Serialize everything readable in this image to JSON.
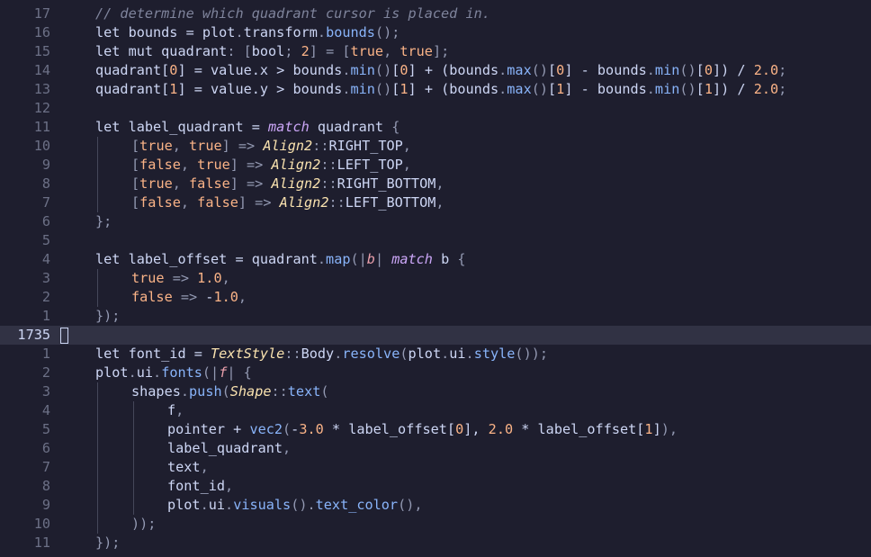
{
  "editor": {
    "current_line_number": "1735",
    "colors": {
      "background": "#1e1e2e",
      "current_line": "#313244",
      "gutter": "#6c7086",
      "text": "#cdd6f4",
      "comment": "#7f849c",
      "number": "#fab387",
      "function": "#89b4fa",
      "type": "#f9e2af",
      "keyword_italic": "#cba6f7"
    },
    "lines": [
      {
        "num": "17",
        "indent": 1,
        "tokens": [
          [
            "c",
            "// determine which quadrant cursor is placed in."
          ]
        ]
      },
      {
        "num": "16",
        "indent": 1,
        "tokens": [
          [
            "k",
            "let "
          ],
          [
            "p",
            "bounds = plot"
          ],
          [
            "u",
            "."
          ],
          [
            "p",
            "transform"
          ],
          [
            "u",
            "."
          ],
          [
            "f",
            "bounds"
          ],
          [
            "u",
            "();"
          ]
        ]
      },
      {
        "num": "15",
        "indent": 1,
        "tokens": [
          [
            "k",
            "let mut "
          ],
          [
            "p",
            "quadrant"
          ],
          [
            "u",
            ": ["
          ],
          [
            "p",
            "bool"
          ],
          [
            "u",
            "; "
          ],
          [
            "n",
            "2"
          ],
          [
            "u",
            "] = ["
          ],
          [
            "n",
            "true"
          ],
          [
            "u",
            ", "
          ],
          [
            "n",
            "true"
          ],
          [
            "u",
            "];"
          ]
        ]
      },
      {
        "num": "14",
        "indent": 1,
        "tokens": [
          [
            "p",
            "quadrant["
          ],
          [
            "n",
            "0"
          ],
          [
            "p",
            "] = value.x > bounds"
          ],
          [
            "u",
            "."
          ],
          [
            "f",
            "min"
          ],
          [
            "u",
            "()"
          ],
          [
            "p",
            "["
          ],
          [
            "n",
            "0"
          ],
          [
            "p",
            "] + (bounds"
          ],
          [
            "u",
            "."
          ],
          [
            "f",
            "max"
          ],
          [
            "u",
            "()"
          ],
          [
            "p",
            "["
          ],
          [
            "n",
            "0"
          ],
          [
            "p",
            "] - bounds"
          ],
          [
            "u",
            "."
          ],
          [
            "f",
            "min"
          ],
          [
            "u",
            "()"
          ],
          [
            "p",
            "["
          ],
          [
            "n",
            "0"
          ],
          [
            "p",
            "]) / "
          ],
          [
            "n",
            "2.0"
          ],
          [
            "u",
            ";"
          ]
        ]
      },
      {
        "num": "13",
        "indent": 1,
        "tokens": [
          [
            "p",
            "quadrant["
          ],
          [
            "n",
            "1"
          ],
          [
            "p",
            "] = value.y > bounds"
          ],
          [
            "u",
            "."
          ],
          [
            "f",
            "min"
          ],
          [
            "u",
            "()"
          ],
          [
            "p",
            "["
          ],
          [
            "n",
            "1"
          ],
          [
            "p",
            "] + (bounds"
          ],
          [
            "u",
            "."
          ],
          [
            "f",
            "max"
          ],
          [
            "u",
            "()"
          ],
          [
            "p",
            "["
          ],
          [
            "n",
            "1"
          ],
          [
            "p",
            "] - bounds"
          ],
          [
            "u",
            "."
          ],
          [
            "f",
            "min"
          ],
          [
            "u",
            "()"
          ],
          [
            "p",
            "["
          ],
          [
            "n",
            "1"
          ],
          [
            "p",
            "]) / "
          ],
          [
            "n",
            "2.0"
          ],
          [
            "u",
            ";"
          ]
        ]
      },
      {
        "num": "12",
        "indent": 0,
        "tokens": []
      },
      {
        "num": "11",
        "indent": 1,
        "tokens": [
          [
            "k",
            "let "
          ],
          [
            "p",
            "label_quadrant = "
          ],
          [
            "i",
            "match"
          ],
          [
            "p",
            " quadrant "
          ],
          [
            "u",
            "{"
          ]
        ]
      },
      {
        "num": "10",
        "indent": 2,
        "tokens": [
          [
            "u",
            "["
          ],
          [
            "n",
            "true"
          ],
          [
            "u",
            ", "
          ],
          [
            "n",
            "true"
          ],
          [
            "u",
            "] => "
          ],
          [
            "t",
            "Align2"
          ],
          [
            "u",
            "::"
          ],
          [
            "p",
            "RIGHT_TOP"
          ],
          [
            "u",
            ","
          ]
        ]
      },
      {
        "num": "9",
        "indent": 2,
        "tokens": [
          [
            "u",
            "["
          ],
          [
            "n",
            "false"
          ],
          [
            "u",
            ", "
          ],
          [
            "n",
            "true"
          ],
          [
            "u",
            "] => "
          ],
          [
            "t",
            "Align2"
          ],
          [
            "u",
            "::"
          ],
          [
            "p",
            "LEFT_TOP"
          ],
          [
            "u",
            ","
          ]
        ]
      },
      {
        "num": "8",
        "indent": 2,
        "tokens": [
          [
            "u",
            "["
          ],
          [
            "n",
            "true"
          ],
          [
            "u",
            ", "
          ],
          [
            "n",
            "false"
          ],
          [
            "u",
            "] => "
          ],
          [
            "t",
            "Align2"
          ],
          [
            "u",
            "::"
          ],
          [
            "p",
            "RIGHT_BOTTOM"
          ],
          [
            "u",
            ","
          ]
        ]
      },
      {
        "num": "7",
        "indent": 2,
        "tokens": [
          [
            "u",
            "["
          ],
          [
            "n",
            "false"
          ],
          [
            "u",
            ", "
          ],
          [
            "n",
            "false"
          ],
          [
            "u",
            "] => "
          ],
          [
            "t",
            "Align2"
          ],
          [
            "u",
            "::"
          ],
          [
            "p",
            "LEFT_BOTTOM"
          ],
          [
            "u",
            ","
          ]
        ]
      },
      {
        "num": "6",
        "indent": 1,
        "tokens": [
          [
            "u",
            "};"
          ]
        ]
      },
      {
        "num": "5",
        "indent": 0,
        "tokens": []
      },
      {
        "num": "4",
        "indent": 1,
        "tokens": [
          [
            "k",
            "let "
          ],
          [
            "p",
            "label_offset = quadrant"
          ],
          [
            "u",
            "."
          ],
          [
            "f",
            "map"
          ],
          [
            "u",
            "(|"
          ],
          [
            "a",
            "b"
          ],
          [
            "u",
            "| "
          ],
          [
            "i",
            "match"
          ],
          [
            "p",
            " b "
          ],
          [
            "u",
            "{"
          ]
        ]
      },
      {
        "num": "3",
        "indent": 2,
        "tokens": [
          [
            "n",
            "true"
          ],
          [
            "u",
            " => "
          ],
          [
            "n",
            "1.0"
          ],
          [
            "u",
            ","
          ]
        ]
      },
      {
        "num": "2",
        "indent": 2,
        "tokens": [
          [
            "n",
            "false"
          ],
          [
            "u",
            " => "
          ],
          [
            "p",
            "-"
          ],
          [
            "n",
            "1.0"
          ],
          [
            "u",
            ","
          ]
        ]
      },
      {
        "num": "1",
        "indent": 1,
        "tokens": [
          [
            "u",
            "});"
          ]
        ]
      },
      {
        "num": "1735",
        "indent": 0,
        "current": true,
        "tokens": []
      },
      {
        "num": "1",
        "indent": 1,
        "tokens": [
          [
            "k",
            "let "
          ],
          [
            "p",
            "font_id = "
          ],
          [
            "t",
            "TextStyle"
          ],
          [
            "u",
            "::"
          ],
          [
            "p",
            "Body"
          ],
          [
            "u",
            "."
          ],
          [
            "f",
            "resolve"
          ],
          [
            "u",
            "("
          ],
          [
            "p",
            "plot"
          ],
          [
            "u",
            "."
          ],
          [
            "p",
            "ui"
          ],
          [
            "u",
            "."
          ],
          [
            "f",
            "style"
          ],
          [
            "u",
            "());"
          ]
        ]
      },
      {
        "num": "2",
        "indent": 1,
        "tokens": [
          [
            "p",
            "plot"
          ],
          [
            "u",
            "."
          ],
          [
            "p",
            "ui"
          ],
          [
            "u",
            "."
          ],
          [
            "f",
            "fonts"
          ],
          [
            "u",
            "(|"
          ],
          [
            "a",
            "f"
          ],
          [
            "u",
            "| {"
          ]
        ]
      },
      {
        "num": "3",
        "indent": 2,
        "tokens": [
          [
            "p",
            "shapes"
          ],
          [
            "u",
            "."
          ],
          [
            "f",
            "push"
          ],
          [
            "u",
            "("
          ],
          [
            "t",
            "Shape"
          ],
          [
            "u",
            "::"
          ],
          [
            "f",
            "text"
          ],
          [
            "u",
            "("
          ]
        ]
      },
      {
        "num": "4",
        "indent": 3,
        "tokens": [
          [
            "p",
            "f"
          ],
          [
            "u",
            ","
          ]
        ]
      },
      {
        "num": "5",
        "indent": 3,
        "tokens": [
          [
            "p",
            "pointer + "
          ],
          [
            "f",
            "vec2"
          ],
          [
            "u",
            "("
          ],
          [
            "p",
            "-"
          ],
          [
            "n",
            "3.0"
          ],
          [
            "p",
            " * label_offset["
          ],
          [
            "n",
            "0"
          ],
          [
            "p",
            "], "
          ],
          [
            "n",
            "2.0"
          ],
          [
            "p",
            " * label_offset["
          ],
          [
            "n",
            "1"
          ],
          [
            "p",
            "]"
          ],
          [
            "u",
            "),"
          ]
        ]
      },
      {
        "num": "6",
        "indent": 3,
        "tokens": [
          [
            "p",
            "label_quadrant"
          ],
          [
            "u",
            ","
          ]
        ]
      },
      {
        "num": "7",
        "indent": 3,
        "tokens": [
          [
            "p",
            "text"
          ],
          [
            "u",
            ","
          ]
        ]
      },
      {
        "num": "8",
        "indent": 3,
        "tokens": [
          [
            "p",
            "font_id"
          ],
          [
            "u",
            ","
          ]
        ]
      },
      {
        "num": "9",
        "indent": 3,
        "tokens": [
          [
            "p",
            "plot"
          ],
          [
            "u",
            "."
          ],
          [
            "p",
            "ui"
          ],
          [
            "u",
            "."
          ],
          [
            "f",
            "visuals"
          ],
          [
            "u",
            "()."
          ],
          [
            "f",
            "text_color"
          ],
          [
            "u",
            "(),"
          ]
        ]
      },
      {
        "num": "10",
        "indent": 2,
        "tokens": [
          [
            "u",
            "));"
          ]
        ]
      },
      {
        "num": "11",
        "indent": 1,
        "tokens": [
          [
            "u",
            "});"
          ]
        ]
      }
    ]
  }
}
